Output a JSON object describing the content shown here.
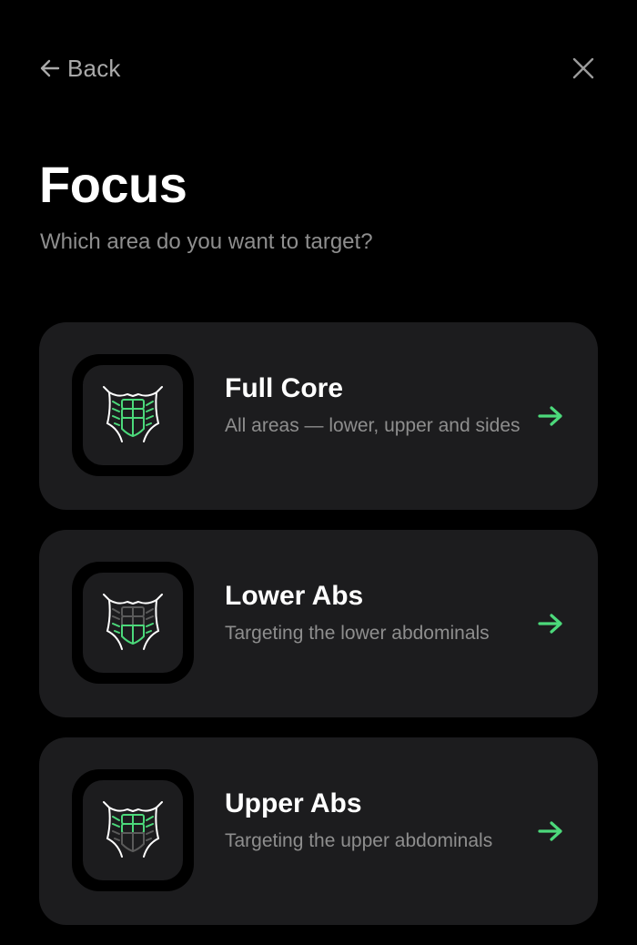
{
  "header": {
    "back_label": "Back",
    "back_icon": "arrow-left-icon",
    "close_icon": "close-icon"
  },
  "page": {
    "title": "Focus",
    "subtitle": "Which area do you want to target?"
  },
  "colors": {
    "background": "#000000",
    "card": "#1c1c1e",
    "accent": "#4cd97b",
    "muted_text": "#8e8e8e"
  },
  "options": [
    {
      "title": "Full Core",
      "description": "All areas — lower, upper and sides",
      "icon": "abs-full-core-icon",
      "highlight": "full",
      "arrow_icon": "arrow-right-icon"
    },
    {
      "title": "Lower Abs",
      "description": "Targeting the lower abdominals",
      "icon": "abs-lower-icon",
      "highlight": "lower",
      "arrow_icon": "arrow-right-icon"
    },
    {
      "title": "Upper Abs",
      "description": "Targeting the upper abdominals",
      "icon": "abs-upper-icon",
      "highlight": "upper",
      "arrow_icon": "arrow-right-icon"
    }
  ]
}
